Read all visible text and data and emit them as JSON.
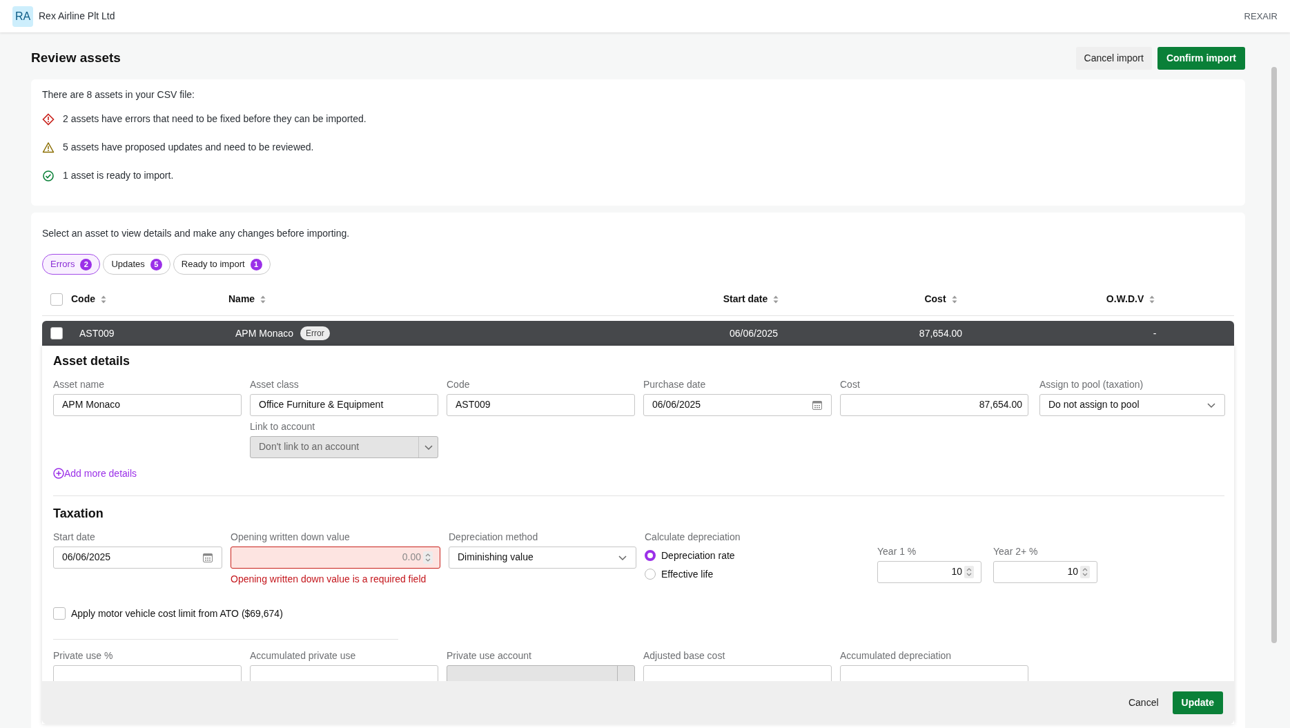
{
  "header": {
    "avatar": "RA",
    "company": "Rex Airline Plt Ltd",
    "org_code": "REXAIR"
  },
  "page": {
    "title": "Review assets",
    "buttons": [
      {
        "label": "Cancel import",
        "kind": "secondary"
      },
      {
        "label": "Confirm import",
        "kind": "primary"
      }
    ]
  },
  "summary": {
    "intro": "There are 8 assets in your CSV file:",
    "items": [
      {
        "kind": "error",
        "text": "2 assets have errors that need to be fixed before they can be imported."
      },
      {
        "kind": "warning",
        "text": "5 assets have proposed updates and need to be reviewed."
      },
      {
        "kind": "ready",
        "text": "1 asset is ready to import."
      }
    ]
  },
  "review": {
    "instruction": "Select an asset to view details and make any changes before importing.",
    "filters": [
      {
        "label": "Errors",
        "count": "2",
        "selected": true
      },
      {
        "label": "Updates",
        "count": "5",
        "selected": false
      },
      {
        "label": "Ready to import",
        "count": "1",
        "selected": false
      }
    ],
    "table": {
      "select_all_checked": false,
      "columns": [
        "Code",
        "Name",
        "Start date",
        "Cost",
        "O.W.D.V"
      ],
      "rows": [
        {
          "code": "AST009",
          "name": "APM Monaco",
          "badge": "Error",
          "start_date": "06/06/2025",
          "cost": "87,654.00",
          "owdv": "-",
          "checked": false,
          "expanded": true
        }
      ]
    }
  },
  "asset_details": {
    "title": "Asset details",
    "fields": [
      {
        "label": "Asset name",
        "value": "APM Monaco",
        "kind": "text"
      },
      {
        "label": "Asset class",
        "value": "Office Furniture & Equipment",
        "kind": "text"
      },
      {
        "label": "Code",
        "value": "AST009",
        "kind": "text"
      },
      {
        "label": "Purchase date",
        "value": "06/06/2025",
        "kind": "date"
      },
      {
        "label": "Cost",
        "value": "87,654.00",
        "kind": "amount"
      },
      {
        "label": "Assign to pool (taxation)",
        "value": "Do not assign to pool",
        "kind": "select"
      }
    ],
    "link_account": {
      "label": "Link to account",
      "value": "Don't link to an account",
      "disabled": true
    },
    "add_more": "Add more details"
  },
  "taxation": {
    "title": "Taxation",
    "start_date": {
      "label": "Start date",
      "value": "06/06/2025"
    },
    "owdv": {
      "label": "Opening written down value",
      "placeholder": "0.00",
      "error": "Opening written down value is a required field"
    },
    "method": {
      "label": "Depreciation method",
      "value": "Diminishing value"
    },
    "calculate": {
      "label": "Calculate depreciation",
      "options": [
        {
          "label": "Depreciation rate",
          "selected": true
        },
        {
          "label": "Effective life",
          "selected": false
        }
      ]
    },
    "rates": [
      {
        "label": "Year 1 %",
        "value": "10"
      },
      {
        "label": "Year 2+ %",
        "value": "10"
      }
    ],
    "motor_limit": {
      "label": "Apply motor vehicle cost limit from ATO ($69,674)",
      "checked": false
    },
    "private_use": [
      {
        "label": "Private use %",
        "disabled": false
      },
      {
        "label": "Accumulated private use",
        "disabled": false
      },
      {
        "label": "Private use account",
        "disabled": true
      },
      {
        "label": "Adjusted base cost",
        "disabled": false
      },
      {
        "label": "Accumulated depreciation",
        "disabled": false
      }
    ]
  },
  "footer": {
    "buttons": [
      {
        "label": "Cancel",
        "kind": "secondary"
      },
      {
        "label": "Update",
        "kind": "primary"
      }
    ]
  }
}
